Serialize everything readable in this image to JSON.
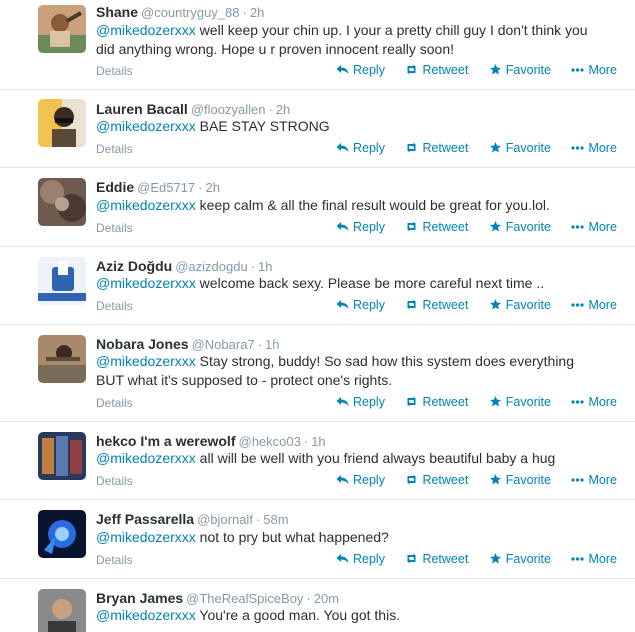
{
  "ui": {
    "details_label": "Details",
    "reply_label": "Reply",
    "retweet_label": "Retweet",
    "favorite_label": "Favorite",
    "more_label": "More",
    "separator": "·"
  },
  "tweets": [
    {
      "name": "Shane",
      "handle": "@countryguy_88",
      "time": "2h",
      "mention": "@mikedozerxxx",
      "text": " well keep your chin up. I your a pretty chill guy I don't think you did anything wrong. Hope u r proven innocent really soon!"
    },
    {
      "name": "Lauren Bacall",
      "handle": "@floozyallen",
      "time": "2h",
      "mention": "@mikedozerxxx",
      "text": " BAE STAY STRONG"
    },
    {
      "name": "Eddie",
      "handle": "@Ed5717",
      "time": "2h",
      "mention": "@mikedozerxxx",
      "text": " keep calm & all the final result would be great for you.lol."
    },
    {
      "name": "Aziz Doğdu",
      "handle": "@azizdogdu",
      "time": "1h",
      "mention": "@mikedozerxxx",
      "text": " welcome back sexy. Please be more careful next time .."
    },
    {
      "name": "Nobara Jones",
      "handle": "@Nobara7",
      "time": "1h",
      "mention": "@mikedozerxxx",
      "text": " Stay strong, buddy! So sad how this system does everything BUT what it's supposed to - protect one's rights."
    },
    {
      "name": "hekco I'm a werewolf",
      "handle": "@hekco03",
      "time": "1h",
      "mention": "@mikedozerxxx",
      "text": " all will be well with you friend always beautiful baby a hug"
    },
    {
      "name": "Jeff Passarella",
      "handle": "@bjornalf",
      "time": "58m",
      "mention": "@mikedozerxxx",
      "text": " not to pry but what happened?"
    },
    {
      "name": "Bryan James",
      "handle": "@TheRealSpiceBoy",
      "time": "20m",
      "mention": "@mikedozerxxx",
      "text": " You're a good man. You got this."
    }
  ]
}
